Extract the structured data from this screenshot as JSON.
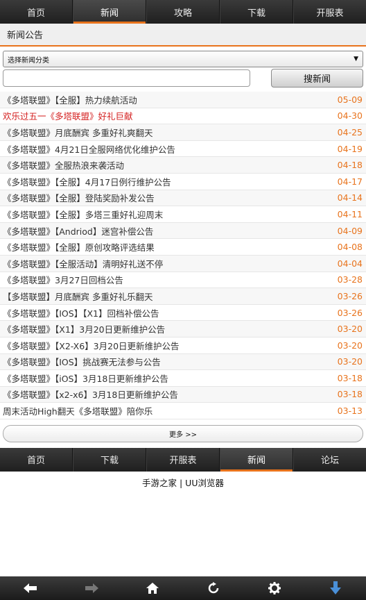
{
  "top_nav": {
    "tabs": [
      {
        "label": "首页"
      },
      {
        "label": "新闻"
      },
      {
        "label": "攻略"
      },
      {
        "label": "下载"
      },
      {
        "label": "开服表"
      }
    ],
    "active": "新闻"
  },
  "section_title": "新闻公告",
  "filter": {
    "select_label": "选择新闻分类",
    "search_placeholder": "",
    "search_button": "搜新闻"
  },
  "news": [
    {
      "title": "《多塔联盟》【全服】热力续航活动",
      "date": "05-09",
      "highlight": false
    },
    {
      "title": "欢乐过五一《多塔联盟》好礼巨献",
      "date": "04-30",
      "highlight": true
    },
    {
      "title": "《多塔联盟》月底酬宾 多重好礼爽翻天",
      "date": "04-25",
      "highlight": false
    },
    {
      "title": "《多塔联盟》4月21日全服网络优化维护公告",
      "date": "04-19",
      "highlight": false
    },
    {
      "title": "《多塔联盟》全服热浪来袭活动",
      "date": "04-18",
      "highlight": false
    },
    {
      "title": "《多塔联盟》【全服】4月17日例行维护公告",
      "date": "04-17",
      "highlight": false
    },
    {
      "title": "《多塔联盟》【全服】登陆奖励补发公告",
      "date": "04-14",
      "highlight": false
    },
    {
      "title": "《多塔联盟》【全服】多塔三重好礼迎周末",
      "date": "04-11",
      "highlight": false
    },
    {
      "title": "《多塔联盟》【Andriod】迷宫补偿公告",
      "date": "04-09",
      "highlight": false
    },
    {
      "title": "《多塔联盟》【全服】原创攻略评选结果",
      "date": "04-08",
      "highlight": false
    },
    {
      "title": "《多塔联盟》【全服活动】清明好礼送不停",
      "date": "04-04",
      "highlight": false
    },
    {
      "title": "《多塔联盟》3月27日回档公告",
      "date": "03-28",
      "highlight": false
    },
    {
      "title": "【多塔联盟】月底酬宾 多重好礼乐翻天",
      "date": "03-26",
      "highlight": false
    },
    {
      "title": "《多塔联盟》【IOS】【X1】回档补偿公告",
      "date": "03-26",
      "highlight": false
    },
    {
      "title": "《多塔联盟》【X1】3月20日更新维护公告",
      "date": "03-20",
      "highlight": false
    },
    {
      "title": "《多塔联盟》【X2-X6】3月20日更新维护公告",
      "date": "03-20",
      "highlight": false
    },
    {
      "title": "《多塔联盟》【IOS】挑战赛无法参与公告",
      "date": "03-20",
      "highlight": false
    },
    {
      "title": "《多塔联盟》【iOS】3月18日更新维护公告",
      "date": "03-18",
      "highlight": false
    },
    {
      "title": "《多塔联盟》【x2-x6】3月18日更新维护公告",
      "date": "03-18",
      "highlight": false
    },
    {
      "title": "周末活动High翻天《多塔联盟》陪你乐",
      "date": "03-13",
      "highlight": false
    }
  ],
  "more_label": "更多 >>",
  "bottom_nav": {
    "tabs": [
      {
        "label": "首页"
      },
      {
        "label": "下载"
      },
      {
        "label": "开服表"
      },
      {
        "label": "新闻"
      },
      {
        "label": "论坛"
      }
    ],
    "active": "新闻"
  },
  "footer": "手游之家 | UU浏览器",
  "browser_toolbar": {
    "buttons": [
      {
        "icon": "back-arrow-icon",
        "color": "#ffffff"
      },
      {
        "icon": "forward-arrow-icon",
        "color": "#777777"
      },
      {
        "icon": "home-icon",
        "color": "#ffffff"
      },
      {
        "icon": "refresh-icon",
        "color": "#ffffff"
      },
      {
        "icon": "settings-gear-icon",
        "color": "#ffffff"
      },
      {
        "icon": "download-arrow-icon",
        "color": "#4a90d9"
      }
    ]
  },
  "colors": {
    "accent": "#e8731c",
    "highlight_text": "#d41f1f",
    "nav_bg": "#2a2a2a"
  }
}
